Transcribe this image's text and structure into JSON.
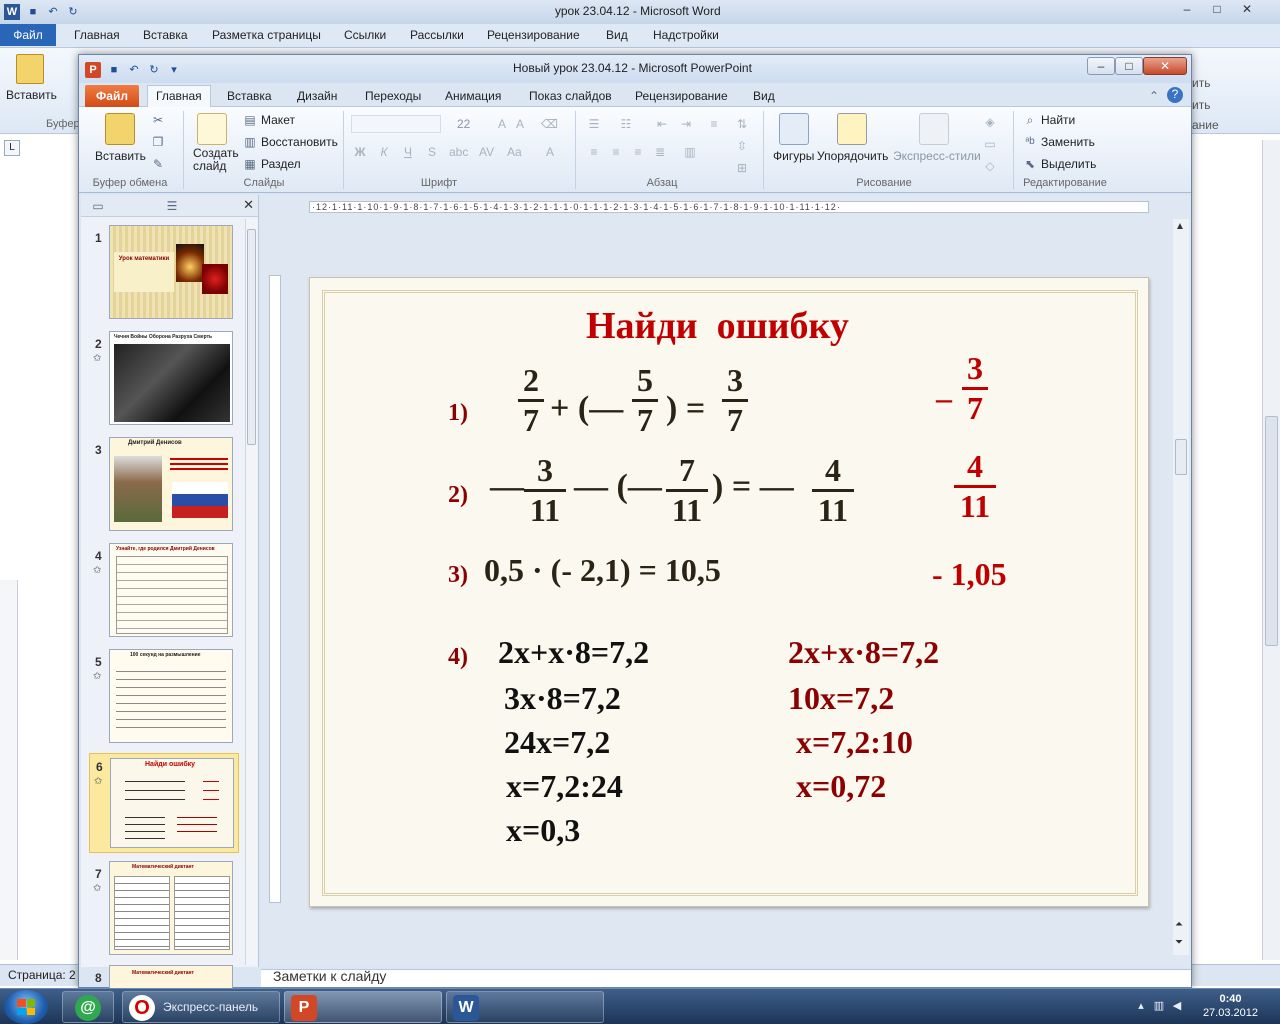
{
  "word": {
    "title": "урок 23.04.12  -  Microsoft Word",
    "file_tab": "Файл",
    "tabs": [
      "Главная",
      "Вставка",
      "Разметка страницы",
      "Ссылки",
      "Рассылки",
      "Рецензирование",
      "Вид",
      "Надстройки"
    ],
    "paste_label": "Вставить",
    "clipboard_group": "Буфер",
    "right_labels": [
      "ить",
      "ить",
      "ание"
    ],
    "status_page": "Страница: 2",
    "ruler_corner": "L"
  },
  "ppt": {
    "title": "Новый урок 23.04.12  -  Microsoft PowerPoint",
    "file_tab": "Файл",
    "tabs": [
      "Главная",
      "Вставка",
      "Дизайн",
      "Переходы",
      "Анимация",
      "Показ слайдов",
      "Рецензирование",
      "Вид"
    ],
    "ribbon": {
      "paste": "Вставить",
      "clipboard_group": "Буфер обмена",
      "new_slide": "Создать слайд",
      "layout": "Макет",
      "reset": "Восстановить",
      "section": "Раздел",
      "slides_group": "Слайды",
      "font_size": "22",
      "font_group": "Шрифт",
      "paragraph_group": "Абзац",
      "shapes": "Фигуры",
      "arrange": "Упорядочить",
      "quick_styles": "Экспресс-стили",
      "drawing_group": "Рисование",
      "find": "Найти",
      "replace": "Заменить",
      "select": "Выделить",
      "editing_group": "Редактирование"
    },
    "thumbnails": [
      {
        "num": "1",
        "title": "Урок математики"
      },
      {
        "num": "2",
        "title": "Чечня Войны Оборона Разруха Смерть"
      },
      {
        "num": "3",
        "title": "Дмитрий Денисов"
      },
      {
        "num": "4",
        "title": "Узнайте, где родился Дмитрий Денисов"
      },
      {
        "num": "5",
        "title": "100 секунд на размышление"
      },
      {
        "num": "6",
        "title": "Найди ошибку"
      },
      {
        "num": "7",
        "title": "Математический диктант"
      },
      {
        "num": "8",
        "title": "Математический диктант"
      }
    ],
    "hruler_text": "·12·1·11·1·10·1·9·1·8·1·7·1·6·1·5·1·4·1·3·1·2·1·1·1·0·1·1·1·2·1·3·1·4·1·5·1·6·1·7·1·8·1·9·1·10·1·11·1·12·",
    "notes_placeholder": "Заметки к слайду"
  },
  "slide": {
    "title": "Найди  ошибку",
    "items": {
      "n1": "1)",
      "n2": "2)",
      "n3": "3)",
      "n4": "4)"
    },
    "eq1": {
      "a_num": "2",
      "a_den": "7",
      "plus_open": "+ (—",
      "b_num": "5",
      "b_den": "7",
      "close_eq": ") =",
      "c_num": "3",
      "c_den": "7"
    },
    "ans1": {
      "sign": "–",
      "num": "3",
      "den": "7"
    },
    "eq2": {
      "lead": "—",
      "a_num": "3",
      "a_den": "11",
      "minus_open": "— (—",
      "b_num": "7",
      "b_den": "11",
      "close_eq": ") = —",
      "c_num": "4",
      "c_den": "11"
    },
    "ans2": {
      "num": "4",
      "den": "11"
    },
    "eq3": "0,5 · (- 2,1) = 10,5",
    "ans3": "- 1,05",
    "wrong_steps": [
      "2x+x·8=7,2",
      "3x·8=7,2",
      "24x=7,2",
      "x=7,2:24",
      "x=0,3"
    ],
    "right_steps": [
      "2x+x·8=7,2",
      "10x=7,2",
      "x=7,2:10",
      "x=0,72"
    ]
  },
  "taskbar": {
    "opera_label": "Экспресс-панель",
    "time": "0:40",
    "date": "27.03.2012"
  }
}
